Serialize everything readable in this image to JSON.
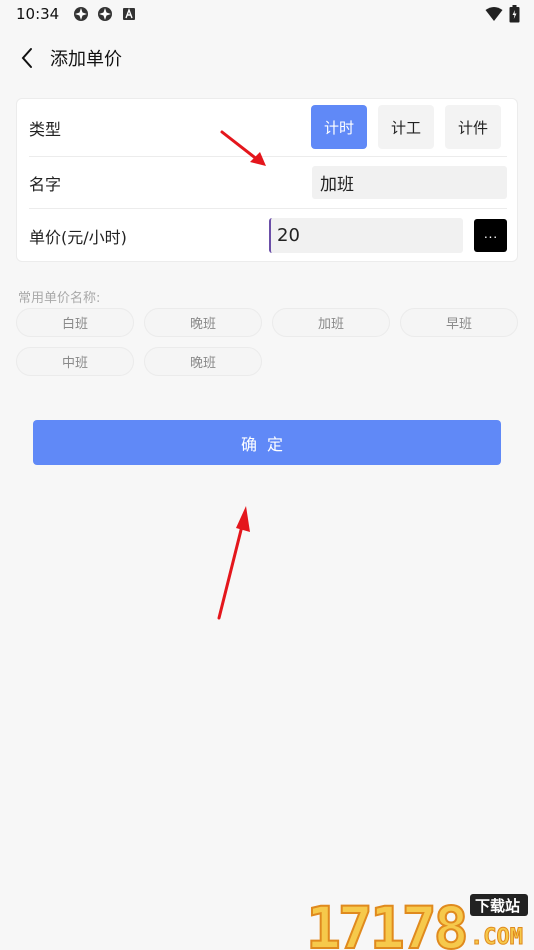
{
  "status_bar": {
    "time": "10:34",
    "left_icons": [
      "app-icon",
      "app-icon",
      "a-icon"
    ],
    "right_icons": [
      "wifi-icon",
      "battery-icon"
    ]
  },
  "app_bar": {
    "title": "添加单价"
  },
  "form": {
    "type": {
      "label": "类型",
      "options": [
        "计时",
        "计工",
        "计件"
      ],
      "selected": "计时"
    },
    "name": {
      "label": "名字",
      "value": "加班"
    },
    "price": {
      "label": "单价(元/小时)",
      "value": "20",
      "more_label": "···"
    }
  },
  "common_names": {
    "label": "常用单价名称:",
    "items": [
      "白班",
      "晚班",
      "加班",
      "早班",
      "中班",
      "晚班"
    ]
  },
  "confirm_label": "确定",
  "colors": {
    "accent": "#6089f7",
    "arrow": "#e4161c"
  },
  "watermark": {
    "number": "17178",
    "site": "下载站",
    "domain": ".COM"
  }
}
